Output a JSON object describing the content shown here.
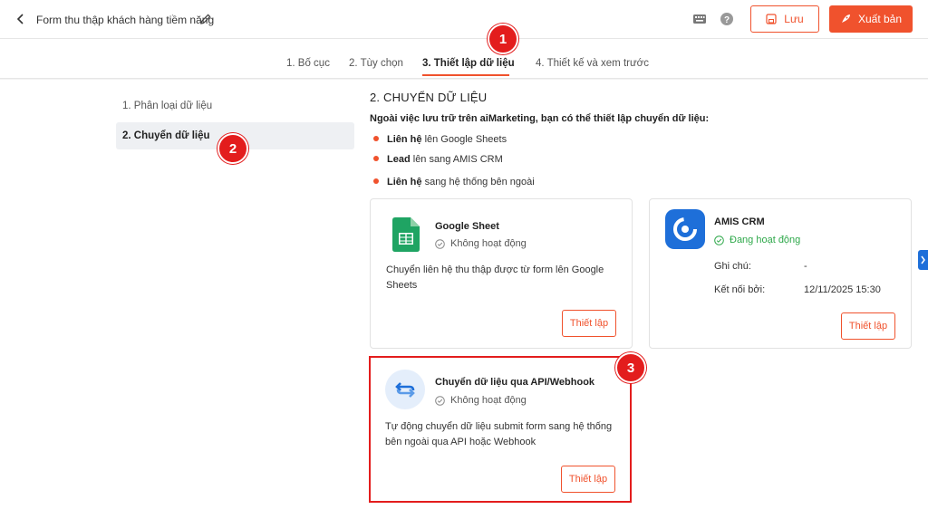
{
  "header": {
    "form_title": "Form thu thập khách hàng tiềm năng",
    "save_label": "Lưu",
    "publish_label": "Xuất bản"
  },
  "tabs": [
    {
      "label": "1. Bố cục"
    },
    {
      "label": "2. Tùy chọn"
    },
    {
      "label": "3. Thiết lập dữ liệu"
    },
    {
      "label": "4. Thiết kế và xem trước"
    }
  ],
  "sidebar": {
    "items": [
      {
        "label": "1. Phân loại dữ liệu"
      },
      {
        "label": "2. Chuyển dữ liệu"
      }
    ]
  },
  "content": {
    "title": "2. CHUYỂN DỮ LIỆU",
    "intro": "Ngoài việc lưu trữ trên aiMarketing, bạn có thể thiết lập chuyển dữ liệu:",
    "bullets": [
      {
        "bold": "Liên hệ",
        "text": " lên Google Sheets"
      },
      {
        "bold": "Lead",
        "text": " lên sang AMIS CRM"
      },
      {
        "bold": "Liên hệ",
        "text": " sang hệ thống bên ngoài"
      }
    ]
  },
  "cards": {
    "google": {
      "name": "Google Sheet",
      "status": "Không hoạt động",
      "desc": "Chuyển liên hệ thu thập được từ form lên Google Sheets",
      "button": "Thiết lập"
    },
    "amis": {
      "name": "AMIS CRM",
      "status": "Đang hoạt động",
      "note_label": "Ghi chú:",
      "note_value": "-",
      "connected_label": "Kết nối bởi:",
      "connected_value": "12/11/2025 15:30",
      "button": "Thiết lập"
    },
    "webhook": {
      "name": "Chuyển dữ liệu qua API/Webhook",
      "status": "Không hoạt động",
      "desc": "Tự động chuyển dữ liệu submit form sang hệ thống bên ngoài qua API hoặc Webhook",
      "button": "Thiết lập"
    }
  },
  "markers": [
    "1",
    "2",
    "3"
  ],
  "colors": {
    "accent": "#f0522d",
    "marker": "#e31d1d",
    "active_status": "#2ea84a",
    "sheets_green": "#1fa463",
    "amis_blue": "#1e6fd9"
  },
  "icons": [
    "back-arrow-icon",
    "pencil-icon",
    "keyboard-icon",
    "help-icon",
    "save-icon",
    "rocket-icon",
    "google-sheets-icon",
    "amis-crm-icon",
    "webhook-icon",
    "check-circle-icon",
    "chevron-right-icon"
  ]
}
